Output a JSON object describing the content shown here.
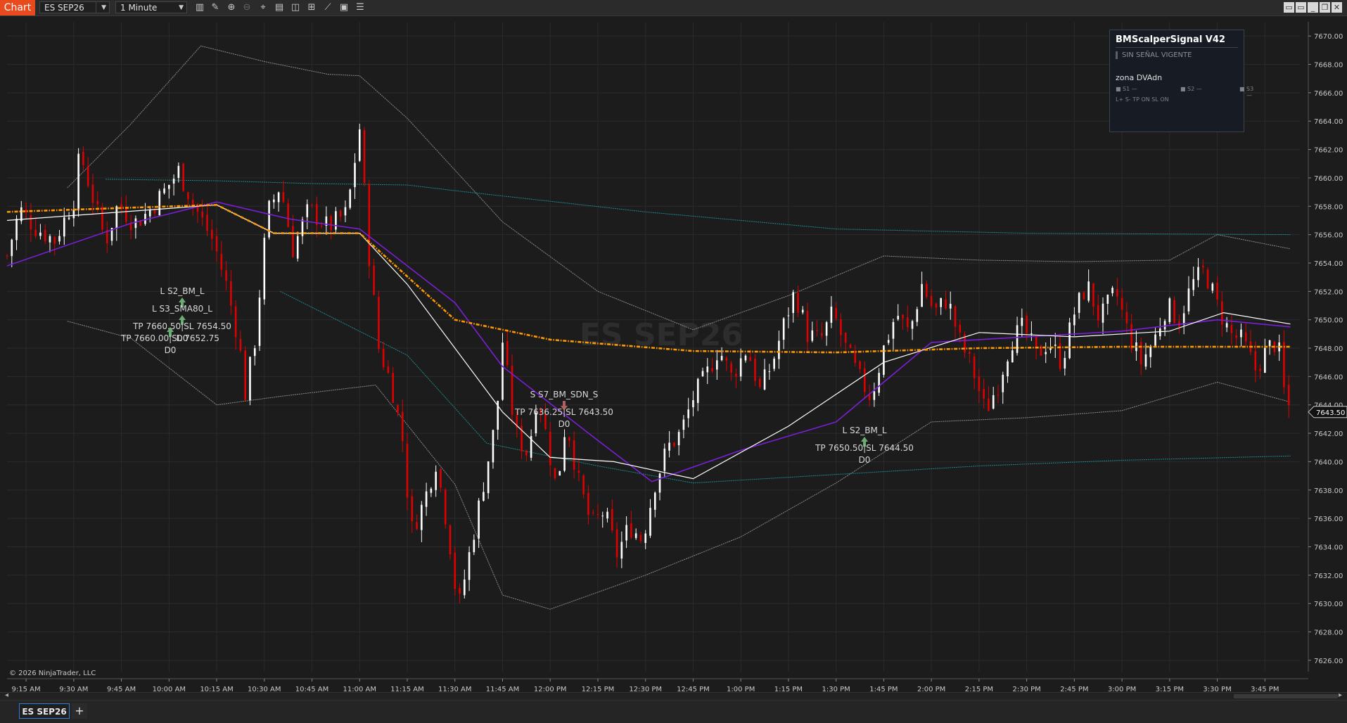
{
  "toolbar": {
    "chart_label": "Chart",
    "instrument": "ES SEP26",
    "interval": "1 Minute",
    "icons": [
      "bar-type-icon",
      "draw-tool-icon",
      "zoom-in-icon",
      "zoom-out-icon",
      "crosshair-icon",
      "data-box-icon",
      "template-icon",
      "strategies-icon",
      "indicators-icon",
      "properties-icon",
      "list-icon"
    ]
  },
  "window_buttons": [
    "tile-icon",
    "tile-icon",
    "minimize-icon",
    "restore-icon",
    "close-icon"
  ],
  "watermark": "ES SEP26",
  "copyright": "© 2026 NinjaTrader, LLC",
  "price_axis": {
    "min": 7626,
    "max": 7670,
    "step": 2,
    "labels": [
      "7670.00",
      "7668.00",
      "7666.00",
      "7664.00",
      "7662.00",
      "7660.00",
      "7658.00",
      "7656.00",
      "7654.00",
      "7652.00",
      "7650.00",
      "7648.00",
      "7646.00",
      "7644.00",
      "7642.00",
      "7640.00",
      "7638.00",
      "7636.00",
      "7634.00",
      "7632.00",
      "7630.00",
      "7628.00",
      "7626.00"
    ],
    "last_price": "7643.50"
  },
  "time_axis": {
    "labels": [
      "9:15 AM",
      "9:30 AM",
      "9:45 AM",
      "10:00 AM",
      "10:15 AM",
      "10:30 AM",
      "10:45 AM",
      "11:00 AM",
      "11:15 AM",
      "11:30 AM",
      "11:45 AM",
      "12:00 PM",
      "12:15 PM",
      "12:30 PM",
      "12:45 PM",
      "1:00 PM",
      "1:15 PM",
      "1:30 PM",
      "1:45 PM",
      "2:00 PM",
      "2:15 PM",
      "2:30 PM",
      "2:45 PM",
      "3:00 PM",
      "3:15 PM",
      "3:30 PM",
      "3:45 PM"
    ]
  },
  "legend": {
    "title": "BMScalperSignal V42",
    "status": "SIN SEÑAL VIGENTE",
    "zone": "zona DVAdn",
    "s1": "S1 —",
    "s2": "S2 —",
    "s3": "S3 —",
    "flags": "L+  S-   TP ON   SL ON"
  },
  "signals": [
    {
      "id": "sig1",
      "label": "L S2_BM_L",
      "dir": "long"
    },
    {
      "id": "sig2",
      "label": "L S3_SMA80_L",
      "tp": "TP 7660.50|SL 7654.50",
      "d": "D0",
      "dir": "long"
    },
    {
      "id": "sig3",
      "tp": "TP 7660.00|SL 7652.75",
      "d": "D0",
      "dir": "long"
    },
    {
      "id": "sig4",
      "label": "S S7_BM_SDN_S",
      "tp": "TP 7636.25|SL 7643.50",
      "d": "D0",
      "dir": "short"
    },
    {
      "id": "sig5",
      "label": "L S2_BM_L",
      "tp": "TP 7650.50|SL 7644.50",
      "d": "D0",
      "dir": "long"
    }
  ],
  "bottom": {
    "tab": "ES SEP26",
    "add": "+"
  },
  "colors": {
    "background": "#1c1c1c",
    "up_candle": "#ffffff",
    "down_candle": "#e00000",
    "vwap": "#ff9900",
    "sma_fast": "#ffffff",
    "sma_slow": "#7a1fd6",
    "bands_outer": "#8a8a8a",
    "bands_inner": "#1a8a8a"
  },
  "chart_data": {
    "type": "candlestick",
    "instrument": "ES SEP26",
    "ylim": [
      7626,
      7670
    ],
    "x_range": [
      "9:09 AM",
      "3:53 PM"
    ],
    "close_path": [
      [
        "9:09 AM",
        7654.5
      ],
      [
        "9:13 AM",
        7657.8
      ],
      [
        "9:18 AM",
        7656.5
      ],
      [
        "9:24 AM",
        7655.6
      ],
      [
        "9:30 AM",
        7658.5
      ],
      [
        "9:32 AM",
        7661.8
      ],
      [
        "9:36 AM",
        7658.6
      ],
      [
        "9:40 AM",
        7655.5
      ],
      [
        "9:44 AM",
        7658.2
      ],
      [
        "9:49 AM",
        7656.8
      ],
      [
        "9:53 AM",
        7657.5
      ],
      [
        "9:58 AM",
        7658.9
      ],
      [
        "10:03 AM",
        7660.5
      ],
      [
        "10:08 AM",
        7658.0
      ],
      [
        "10:14 AM",
        7655.5
      ],
      [
        "10:18 AM",
        7652.5
      ],
      [
        "10:22 AM",
        7648.5
      ],
      [
        "10:24 AM",
        7644.8
      ],
      [
        "10:27 AM",
        7648.5
      ],
      [
        "10:31 AM",
        7657.5
      ],
      [
        "10:35 AM",
        7659.5
      ],
      [
        "10:39 AM",
        7655.0
      ],
      [
        "10:44 AM",
        7657.8
      ],
      [
        "10:50 AM",
        7656.5
      ],
      [
        "10:56 AM",
        7657.5
      ],
      [
        "11:00 AM",
        7663.5
      ],
      [
        "11:03 AM",
        7654.5
      ],
      [
        "11:06 AM",
        7648.0
      ],
      [
        "11:10 AM",
        7645.5
      ],
      [
        "11:14 AM",
        7641.0
      ],
      [
        "11:16 AM",
        7635.0
      ],
      [
        "11:20 AM",
        7637.0
      ],
      [
        "11:24 AM",
        7640.0
      ],
      [
        "11:28 AM",
        7635.0
      ],
      [
        "11:31 AM",
        7629.5
      ],
      [
        "11:35 AM",
        7634.0
      ],
      [
        "11:39 AM",
        7638.5
      ],
      [
        "11:43 AM",
        7643.0
      ],
      [
        "11:45 AM",
        7648.5
      ],
      [
        "11:49 AM",
        7642.0
      ],
      [
        "11:53 AM",
        7640.5
      ],
      [
        "11:56 AM",
        7645.0
      ],
      [
        "11:59 AM",
        7641.5
      ],
      [
        "12:02 PM",
        7638.0
      ],
      [
        "12:05 PM",
        7643.0
      ],
      [
        "12:09 PM",
        7638.5
      ],
      [
        "12:13 PM",
        7635.5
      ],
      [
        "12:17 PM",
        7636.5
      ],
      [
        "12:21 PM",
        7633.5
      ],
      [
        "12:25 PM",
        7635.5
      ],
      [
        "12:29 PM",
        7634.5
      ],
      [
        "12:33 PM",
        7638.5
      ],
      [
        "12:37 PM",
        7641.0
      ],
      [
        "12:41 PM",
        7642.0
      ],
      [
        "12:45 PM",
        7644.5
      ],
      [
        "12:49 PM",
        7646.0
      ],
      [
        "12:53 PM",
        7648.0
      ],
      [
        "12:57 PM",
        7646.0
      ],
      [
        "1:02 PM",
        7648.0
      ],
      [
        "1:06 PM",
        7645.0
      ],
      [
        "1:10 PM",
        7647.0
      ],
      [
        "1:14 PM",
        7650.0
      ],
      [
        "1:17 PM",
        7652.0
      ],
      [
        "1:21 PM",
        7649.0
      ],
      [
        "1:25 PM",
        7648.5
      ],
      [
        "1:29 PM",
        7650.5
      ],
      [
        "1:33 PM",
        7648.0
      ],
      [
        "1:37 PM",
        7646.0
      ],
      [
        "1:41 PM",
        7644.5
      ],
      [
        "1:45 PM",
        7648.0
      ],
      [
        "1:49 PM",
        7650.5
      ],
      [
        "1:53 PM",
        7649.0
      ],
      [
        "1:57 PM",
        7652.5
      ],
      [
        "2:01 PM",
        7650.5
      ],
      [
        "2:05 PM",
        7651.5
      ],
      [
        "2:09 PM",
        7648.5
      ],
      [
        "2:13 PM",
        7646.5
      ],
      [
        "2:17 PM",
        7643.5
      ],
      [
        "2:21 PM",
        7645.5
      ],
      [
        "2:25 PM",
        7648.5
      ],
      [
        "2:29 PM",
        7649.5
      ],
      [
        "2:33 PM",
        7647.5
      ],
      [
        "2:37 PM",
        7648.5
      ],
      [
        "2:41 PM",
        7647.0
      ],
      [
        "2:45 PM",
        7650.5
      ],
      [
        "2:49 PM",
        7652.5
      ],
      [
        "2:53 PM",
        7650.0
      ],
      [
        "2:58 PM",
        7652.0
      ],
      [
        "3:02 PM",
        7649.0
      ],
      [
        "3:06 PM",
        7647.0
      ],
      [
        "3:10 PM",
        7648.5
      ],
      [
        "3:14 PM",
        7651.0
      ],
      [
        "3:18 PM",
        7650.0
      ],
      [
        "3:22 PM",
        7652.5
      ],
      [
        "3:26 PM",
        7653.5
      ],
      [
        "3:30 PM",
        7651.0
      ],
      [
        "3:34 PM",
        7649.0
      ],
      [
        "3:38 PM",
        7648.5
      ],
      [
        "3:42 PM",
        7646.5
      ],
      [
        "3:46 PM",
        7648.0
      ],
      [
        "3:49 PM",
        7648.5
      ],
      [
        "3:51 PM",
        7645.0
      ],
      [
        "3:53 PM",
        7643.5
      ]
    ],
    "overlays": {
      "vwap": [
        [
          "9:09 AM",
          7657.6
        ],
        [
          "9:48 AM",
          7657.9
        ],
        [
          "10:15 AM",
          7658.1
        ],
        [
          "10:33 AM",
          7656.1
        ],
        [
          "11:00 AM",
          7656.1
        ],
        [
          "11:30 AM",
          7650.0
        ],
        [
          "12:00 PM",
          7648.6
        ],
        [
          "12:45 PM",
          7647.8
        ],
        [
          "1:30 PM",
          7647.7
        ],
        [
          "2:15 PM",
          7648.0
        ],
        [
          "3:00 PM",
          7648.1
        ],
        [
          "3:53 PM",
          7648.1
        ]
      ],
      "sma_fast": [
        [
          "9:09 AM",
          7657.0
        ],
        [
          "10:15 AM",
          7658.1
        ],
        [
          "10:33 AM",
          7656.1
        ],
        [
          "11:00 AM",
          7656.1
        ],
        [
          "11:15 AM",
          7652.5
        ],
        [
          "11:45 AM",
          7643.5
        ],
        [
          "12:00 PM",
          7640.3
        ],
        [
          "12:20 PM",
          7640.0
        ],
        [
          "12:45 PM",
          7638.8
        ],
        [
          "1:15 PM",
          7642.5
        ],
        [
          "1:45 PM",
          7647.0
        ],
        [
          "2:15 PM",
          7649.1
        ],
        [
          "2:45 PM",
          7648.8
        ],
        [
          "3:15 PM",
          7649.2
        ],
        [
          "3:32 PM",
          7650.5
        ],
        [
          "3:53 PM",
          7649.7
        ]
      ],
      "sma_slow": [
        [
          "9:09 AM",
          7653.8
        ],
        [
          "9:48 AM",
          7656.8
        ],
        [
          "10:15 AM",
          7658.3
        ],
        [
          "10:38 AM",
          7657.1
        ],
        [
          "11:00 AM",
          7656.4
        ],
        [
          "11:30 AM",
          7651.2
        ],
        [
          "11:45 AM",
          7646.7
        ],
        [
          "12:15 PM",
          7641.5
        ],
        [
          "12:32 PM",
          7638.6
        ],
        [
          "1:00 PM",
          7640.8
        ],
        [
          "1:30 PM",
          7642.8
        ],
        [
          "2:00 PM",
          7648.4
        ],
        [
          "2:30 PM",
          7648.8
        ],
        [
          "3:00 PM",
          7649.2
        ],
        [
          "3:30 PM",
          7650.0
        ],
        [
          "3:53 PM",
          7649.5
        ]
      ],
      "band_outer_upper": [
        [
          "9:28 AM",
          7659.3
        ],
        [
          "9:48 AM",
          7663.8
        ],
        [
          "10:10 AM",
          7669.3
        ],
        [
          "10:30 AM",
          7668.2
        ],
        [
          "10:50 AM",
          7667.3
        ],
        [
          "11:00 AM",
          7667.2
        ],
        [
          "11:15 AM",
          7664.2
        ],
        [
          "11:45 AM",
          7656.9
        ],
        [
          "12:15 PM",
          7652.0
        ],
        [
          "12:45 PM",
          7649.3
        ],
        [
          "1:15 PM",
          7651.7
        ],
        [
          "1:45 PM",
          7654.5
        ],
        [
          "2:15 PM",
          7654.2
        ],
        [
          "2:45 PM",
          7654.1
        ],
        [
          "3:15 PM",
          7654.2
        ],
        [
          "3:30 PM",
          7656.0
        ],
        [
          "3:53 PM",
          7655.0
        ]
      ],
      "band_outer_lower": [
        [
          "9:28 AM",
          7649.9
        ],
        [
          "9:48 AM",
          7648.7
        ],
        [
          "10:15 AM",
          7644.0
        ],
        [
          "10:35 AM",
          7644.6
        ],
        [
          "11:05 AM",
          7645.4
        ],
        [
          "11:30 AM",
          7638.4
        ],
        [
          "11:45 AM",
          7630.6
        ],
        [
          "12:00 PM",
          7629.6
        ],
        [
          "12:30 PM",
          7632.0
        ],
        [
          "1:00 PM",
          7634.7
        ],
        [
          "1:30 PM",
          7638.5
        ],
        [
          "2:00 PM",
          7642.8
        ],
        [
          "2:30 PM",
          7643.1
        ],
        [
          "3:00 PM",
          7643.6
        ],
        [
          "3:30 PM",
          7645.6
        ],
        [
          "3:53 PM",
          7644.2
        ]
      ],
      "band_inner_upper": [
        [
          "9:40 AM",
          7659.9
        ],
        [
          "10:15 AM",
          7659.8
        ],
        [
          "10:45 AM",
          7659.6
        ],
        [
          "11:15 AM",
          7659.5
        ],
        [
          "11:30 AM",
          7659.1
        ],
        [
          "12:30 PM",
          7657.6
        ],
        [
          "1:30 PM",
          7656.4
        ],
        [
          "2:30 PM",
          7656.1
        ],
        [
          "3:53 PM",
          7656.0
        ]
      ],
      "band_inner_lower": [
        [
          "10:35 AM",
          7652.0
        ],
        [
          "11:15 AM",
          7647.5
        ],
        [
          "11:40 AM",
          7641.3
        ],
        [
          "12:15 PM",
          7639.7
        ],
        [
          "12:45 PM",
          7638.5
        ],
        [
          "1:30 PM",
          7639.1
        ],
        [
          "2:15 PM",
          7639.7
        ],
        [
          "3:00 PM",
          7640.1
        ],
        [
          "3:53 PM",
          7640.4
        ]
      ]
    }
  }
}
